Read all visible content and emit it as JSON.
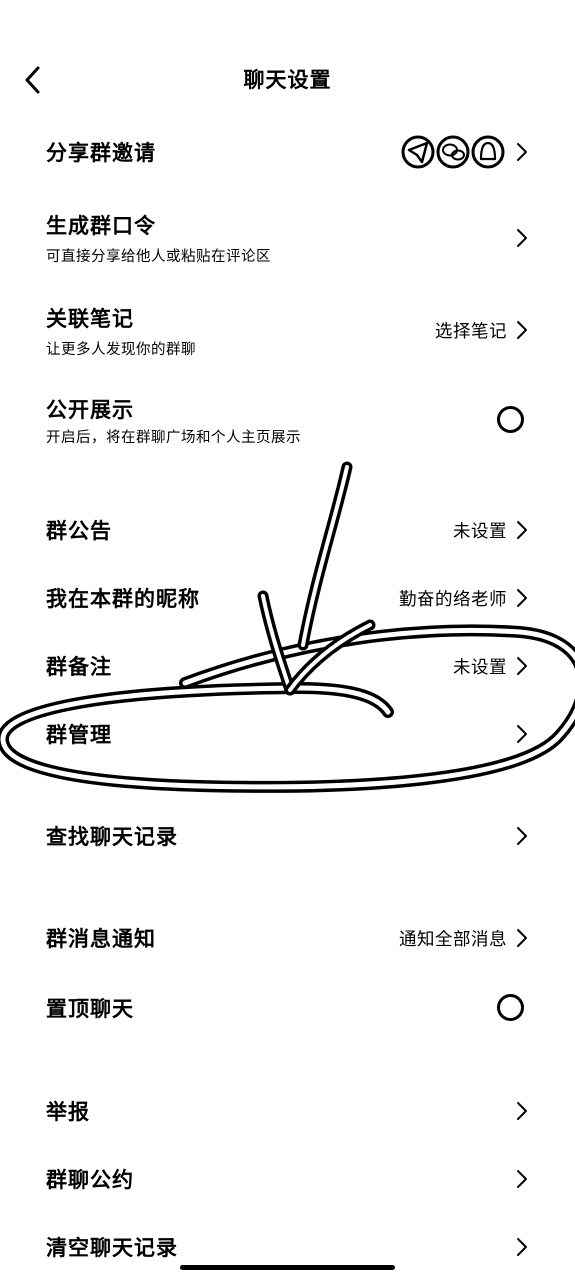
{
  "header": {
    "title": "聊天设置"
  },
  "items": {
    "share_invite": {
      "label": "分享群邀请",
      "icons": [
        "share-channel-1-icon",
        "share-channel-2-icon",
        "share-channel-3-icon"
      ]
    },
    "gen_code": {
      "label": "生成群口令",
      "sub": "可直接分享给他人或粘贴在评论区"
    },
    "link_note": {
      "label": "关联笔记",
      "sub": "让更多人发现你的群聊",
      "value": "选择笔记"
    },
    "public_show": {
      "label": "公开展示",
      "sub": "开启后，将在群聊广场和个人主页展示",
      "toggle": "off"
    },
    "announcement": {
      "label": "群公告",
      "value": "未设置"
    },
    "nickname": {
      "label": "我在本群的昵称",
      "value": "勤奋的络老师"
    },
    "group_remark": {
      "label": "群备注",
      "value": "未设置"
    },
    "group_manage": {
      "label": "群管理"
    },
    "search_history": {
      "label": "查找聊天记录"
    },
    "msg_notify": {
      "label": "群消息通知",
      "value": "通知全部消息"
    },
    "pin_chat": {
      "label": "置顶聊天",
      "toggle": "off"
    },
    "report": {
      "label": "举报"
    },
    "convention": {
      "label": "群聊公约"
    },
    "clear_history": {
      "label": "清空聊天记录"
    }
  },
  "colors": {
    "text": "#000000",
    "background": "#ffffff",
    "annotation": "#000000"
  }
}
